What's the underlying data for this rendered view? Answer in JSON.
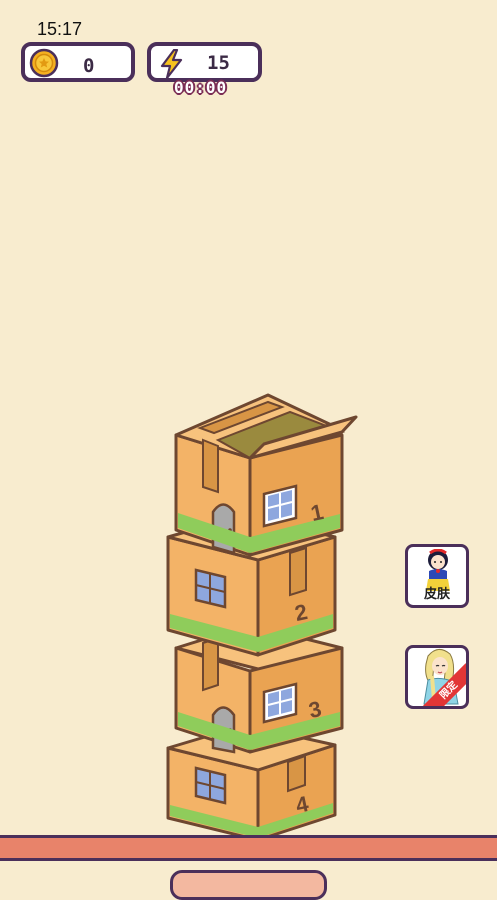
{
  "status_bar": {
    "time": "15:17"
  },
  "hud": {
    "coins": "0",
    "coin_icon": "coin-icon",
    "energy": "15",
    "energy_icon": "lightning-icon",
    "timer": "00:00"
  },
  "tower": {
    "boxes": [
      {
        "number": "1",
        "style": "house-door-window-open-top"
      },
      {
        "number": "2",
        "style": "house-window"
      },
      {
        "number": "3",
        "style": "house-door-window"
      },
      {
        "number": "4",
        "style": "house-window"
      }
    ],
    "colors": {
      "box_front": "#f3b367",
      "box_side": "#eaa352",
      "box_top": "#f7c27d",
      "outline": "#6e4730",
      "grass": "#8fcc5b",
      "window": "#8ea7de",
      "door": "#a9a9a9"
    }
  },
  "side_buttons": {
    "skin_label": "皮肤",
    "limited_label": "限定"
  },
  "colors": {
    "background": "#f8eccf",
    "outline": "#4b2f5a",
    "ground": "#e8836a"
  }
}
